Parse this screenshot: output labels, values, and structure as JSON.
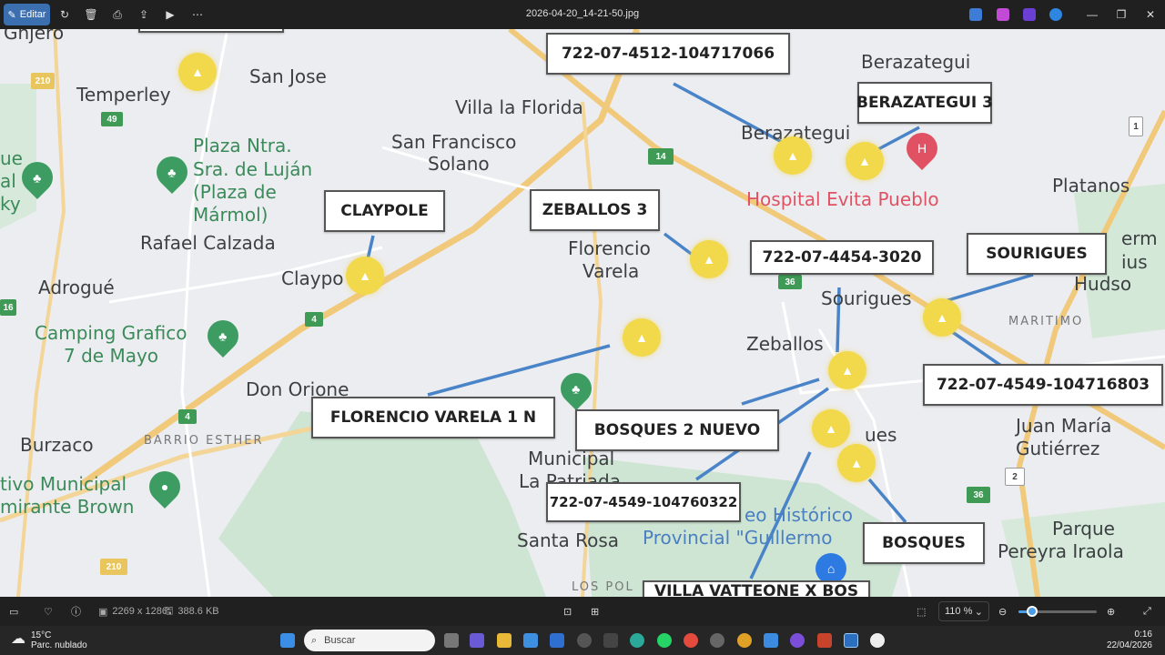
{
  "toolbar": {
    "edit_label": "Editar",
    "filename": "2026-04-20_14-21-50.jpg",
    "icons": [
      "rotate-icon",
      "delete-icon",
      "print-icon",
      "share-icon",
      "slideshow-icon",
      "more-icon"
    ]
  },
  "map": {
    "places": {
      "temperley": "Temperley",
      "san_jose": "San Jose",
      "villa_la_florida": "Villa la Florida",
      "berazategui": "Berazategui",
      "berazategui2": "Berazategui",
      "san_francisco_solano_1": "San Francisco",
      "san_francisco_solano_2": "Solano",
      "plaza_1": "Plaza Ntra.",
      "plaza_2": "Sra. de Luján",
      "plaza_3": "(Plaza de",
      "plaza_4": "Mármol)",
      "hospital": "Hospital Evita Pueblo",
      "platanos": "Platanos",
      "rafael_calzada": "Rafael Calzada",
      "claypole": "Claypo",
      "florencio_1": "Florencio",
      "florencio_2": "Varela",
      "adrogue": "Adrogué",
      "sourigues": "Sourigues",
      "hudson": "Hudso",
      "maritimo": "MARITIMO",
      "camping_1": "Camping Grafico",
      "camping_2": "7 de Mayo",
      "zeballos": "Zeballos",
      "don_orione": "Don Orione",
      "burzaco": "Burzaco",
      "barrio_esther": "BARRIO ESTHER",
      "juan_maria_1": "Juan María",
      "juan_maria_2": "Gutiérrez",
      "municipal_1": "tivo Municipal",
      "municipal_2": "mirante Brown",
      "bosques_place": "ues",
      "la_patriada_1": "Municipal",
      "la_patriada_2": "La Patriada",
      "santa_rosa": "Santa Rosa",
      "museo_1": "eo Histórico",
      "museo_2": "Provincial \"Guillermo",
      "parque_1": "Parque",
      "parque_2": "Pereyra Iraola",
      "los_pol": "LOS POL",
      "ue": "ue",
      "al": "al",
      "ky": "ky",
      "gruero": "Gnjero",
      "ferm": "erm",
      "cius": "ius"
    },
    "labels": {
      "phone_top": "722-07-4512-104717066",
      "berazategui3": "BERAZATEGUI 3",
      "claypole": "CLAYPOLE",
      "zeballos3": "ZEBALLOS 3",
      "phone_mid": "722-07-4454-3020",
      "sourigues": "SOURIGUES",
      "phone_right": "722-07-4549-104716803",
      "florencio_varela": "FLORENCIO VARELA 1 N",
      "bosques2": "BOSQUES 2 NUEVO",
      "phone_bottom": "722-07-4549-104760322",
      "bosques": "BOSQUES",
      "villa_vatteone": "VILLA VATTEONE X BOS"
    },
    "shields": [
      "210",
      "49",
      "14",
      "36",
      "4",
      "4",
      "16",
      "210",
      "2",
      "36",
      "1"
    ]
  },
  "infobar": {
    "dimensions": "2269 x 1286",
    "filesize": "388.6 KB",
    "zoom": "110 %",
    "zoom_fraction": 0.18
  },
  "taskbar": {
    "weather_temp": "15°C",
    "weather_desc": "Parc. nublado",
    "search_placeholder": "Buscar",
    "time": "0:16",
    "date": "22/04/2026"
  }
}
